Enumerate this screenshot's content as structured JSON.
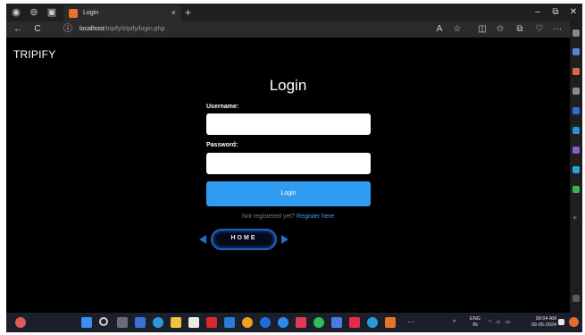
{
  "browser": {
    "tab_title": "Login",
    "tab_close": "×",
    "new_tab": "+",
    "url_host": "localhost",
    "url_path": "/tripify/tripify/login.php",
    "win_min": "–",
    "win_max": "⧉",
    "win_close": "✕",
    "back": "←",
    "reload": "C",
    "info": "ⓘ",
    "more": "···"
  },
  "page": {
    "brand": "TRIPIFY",
    "title": "Login",
    "username_label": "Username:",
    "password_label": "Password:",
    "login_button": "Login",
    "register_prompt": "Not registered yet?",
    "register_link": "Register here",
    "home_button": "HOME"
  },
  "taskbar": {
    "lang_line1": "ENG",
    "lang_line2": "IN",
    "time": "09:04 AM",
    "date": "09-05-2024",
    "overflow": "···",
    "tray_chevron": "^"
  },
  "colors": {
    "accent": "#2f9cf2",
    "home_glow": "#1f6fd6",
    "link": "#3d9ef0"
  }
}
